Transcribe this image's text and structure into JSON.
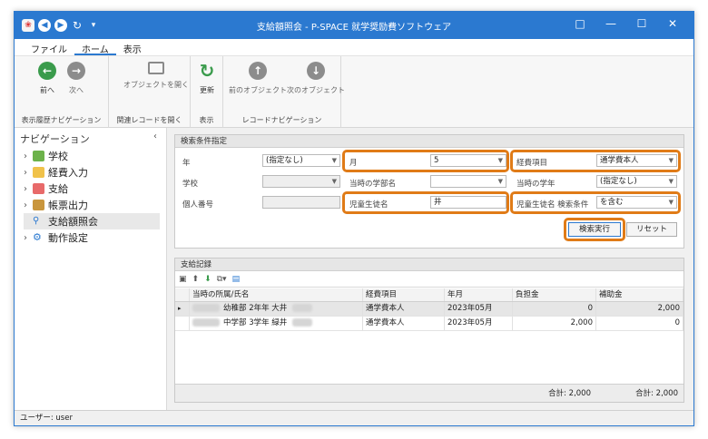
{
  "window": {
    "title": "支給額照会 - P-SPACE 就学奨励費ソフトウェア",
    "controls": {
      "restore_icon": "□",
      "minimize": "—",
      "maximize": "☐",
      "close": "✕"
    }
  },
  "quick_access": {
    "back": "◀",
    "forward": "▶",
    "refresh": "↻",
    "dropdown": "▾"
  },
  "menu": {
    "items": [
      "ファイル",
      "ホーム",
      "表示"
    ],
    "active": "ホーム"
  },
  "ribbon": {
    "groups": [
      {
        "label": "表示履歴ナビゲーション",
        "buttons": [
          "前へ",
          "次へ"
        ]
      },
      {
        "label": "関連レコードを開く",
        "buttons": [
          "オブジェクトを開く"
        ]
      },
      {
        "label": "表示",
        "buttons": [
          "更新"
        ]
      },
      {
        "label": "レコードナビゲーション",
        "buttons": [
          "前のオブジェクト",
          "次のオブジェクト"
        ]
      }
    ]
  },
  "nav": {
    "title": "ナビゲーション",
    "collapse": "‹",
    "items": [
      {
        "label": "学校",
        "expandable": true,
        "icon": "school-icon"
      },
      {
        "label": "経費入力",
        "expandable": true,
        "icon": "folder-icon"
      },
      {
        "label": "支給",
        "expandable": true,
        "icon": "calendar-icon"
      },
      {
        "label": "帳票出力",
        "expandable": true,
        "icon": "report-icon"
      },
      {
        "label": "支給額照会",
        "expandable": false,
        "icon": "search-icon",
        "selected": true
      },
      {
        "label": "動作設定",
        "expandable": true,
        "icon": "gear-icon"
      }
    ]
  },
  "search": {
    "title": "検索条件指定",
    "fields": {
      "year": {
        "label": "年",
        "value": "(指定なし)"
      },
      "month": {
        "label": "月",
        "value": "5"
      },
      "expense_item": {
        "label": "経費項目",
        "value": "通学費本人"
      },
      "school": {
        "label": "学校",
        "value": ""
      },
      "department": {
        "label": "当時の学部名",
        "value": ""
      },
      "grade": {
        "label": "当時の学年",
        "value": "(指定なし)"
      },
      "personal_no": {
        "label": "個人番号",
        "value": ""
      },
      "student_name": {
        "label": "児童生徒名",
        "value": "井"
      },
      "name_condition": {
        "label": "児童生徒名 検索条件",
        "value": "を含む"
      }
    },
    "buttons": {
      "run": "検索実行",
      "reset": "リセット"
    }
  },
  "results": {
    "title": "支給記録",
    "columns": [
      "当時の所属/氏名",
      "経費項目",
      "年月",
      "負担金",
      "補助金"
    ],
    "rows": [
      {
        "affiliation": "幼稚部 2年年 大井",
        "item": "通学費本人",
        "month": "2023年05月",
        "burden": "0",
        "subsidy": "2,000"
      },
      {
        "affiliation": "中学部 3学年 緑井",
        "item": "通学費本人",
        "month": "2023年05月",
        "burden": "2,000",
        "subsidy": "0"
      }
    ],
    "totals": {
      "burden": "合計: 2,000",
      "subsidy": "合計: 2,000"
    }
  },
  "status": {
    "user": "ユーザー: user"
  },
  "colors": {
    "accent": "#2b79d0",
    "highlight": "#e07b17",
    "green": "#3a9b4c"
  }
}
